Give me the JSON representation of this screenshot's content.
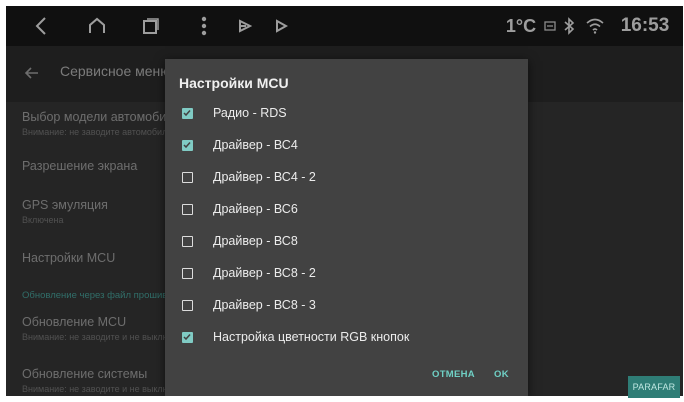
{
  "status_bar": {
    "temperature": "1°C",
    "time": "16:53",
    "icons": [
      "back-icon",
      "home-icon",
      "recents-icon",
      "more-vert-icon",
      "cast-icon",
      "play-icon",
      "sim-icon",
      "bluetooth-icon",
      "wifi-icon"
    ]
  },
  "app_bar": {
    "title": "Сервисное меню"
  },
  "settings": [
    {
      "title": "Выбор модели автомобиля",
      "subtitle": "Внимание: не заводите автомобиль"
    },
    {
      "title": "Разрешение экрана",
      "subtitle": ""
    },
    {
      "title": "GPS эмуляция",
      "subtitle": "Включена"
    },
    {
      "title": "Настройки MCU",
      "subtitle": ""
    },
    {
      "title": "Обновление MCU",
      "subtitle": "Внимание: не заводите и не выключайте"
    },
    {
      "title": "Обновление системы",
      "subtitle": "Внимание: не заводите и не выключайте"
    }
  ],
  "section_label": "Обновление через файл прошивки",
  "dialog": {
    "title": "Настройки MCU",
    "options": [
      {
        "label": "Радио - RDS",
        "checked": true
      },
      {
        "label": "Драйвер - ВС4",
        "checked": true
      },
      {
        "label": "Драйвер - ВС4 - 2",
        "checked": false
      },
      {
        "label": "Драйвер - ВС6",
        "checked": false
      },
      {
        "label": "Драйвер - ВС8",
        "checked": false
      },
      {
        "label": "Драйвер - ВС8 - 2",
        "checked": false
      },
      {
        "label": "Драйвер - ВС8 - 3",
        "checked": false
      },
      {
        "label": "Настройка цветности RGB кнопок",
        "checked": true
      }
    ],
    "cancel_label": "ОТМЕНА",
    "ok_label": "OK"
  },
  "watermark": "PARAFAR",
  "colors": {
    "accent": "#80cbc4",
    "status_bar": "#1a1a1a",
    "dialog": "#424242"
  }
}
